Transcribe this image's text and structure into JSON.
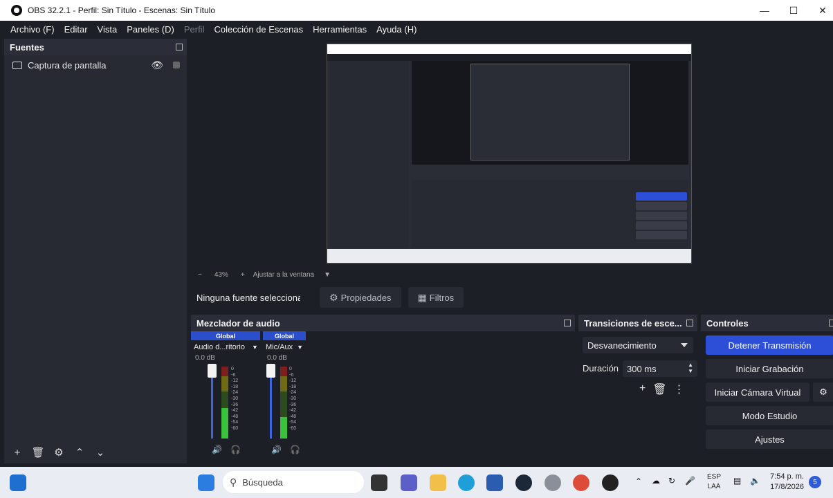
{
  "window": {
    "title": "OBS 32.2.1 - Perfil: Sin Título - Escenas: Sin Título"
  },
  "menu": [
    "Archivo (F)",
    "Editar",
    "Vista",
    "Paneles (D)",
    "Perfil",
    "Colección de Escenas",
    "Herramientas",
    "Ayuda (H)"
  ],
  "sources": {
    "title": "Fuentes",
    "items": [
      {
        "label": "Captura de pantalla",
        "visible": true,
        "locked": false
      }
    ]
  },
  "zoom": {
    "level": "43%",
    "fit_label": "Ajustar a la ventana"
  },
  "source_bar": {
    "status": "Ninguna fuente seleccionada",
    "properties": "Propiedades",
    "filters": "Filtros"
  },
  "mixer": {
    "title": "Mezclador de audio",
    "channels": [
      {
        "group": "Global",
        "name": "Audio d...ritorio",
        "db": "0.0 dB",
        "level": 0.65
      },
      {
        "group": "Global",
        "name": "Mic/Aux",
        "db": "0.0 dB",
        "level": 0.45
      }
    ],
    "scale": [
      "0",
      "-6",
      "-12",
      "-18",
      "-24",
      "-30",
      "-36",
      "-42",
      "-48",
      "-54",
      "-60"
    ]
  },
  "transitions": {
    "title": "Transiciones de esce...",
    "selected": "Desvanecimiento",
    "duration_label": "Duración",
    "duration_value": "300 ms"
  },
  "controls": {
    "title": "Controles",
    "stop_stream": "Detener Transmisión",
    "start_recording": "Iniciar Grabación",
    "start_virtual_cam": "Iniciar Cámara Virtual",
    "studio_mode": "Modo Estudio",
    "settings": "Ajustes"
  },
  "taskbar": {
    "search_placeholder": "Búsqueda",
    "lang_line1": "ESP",
    "lang_line2": "LAA",
    "time": "7:54 p. m.",
    "date": "17/8/2026",
    "notifications": "5"
  }
}
